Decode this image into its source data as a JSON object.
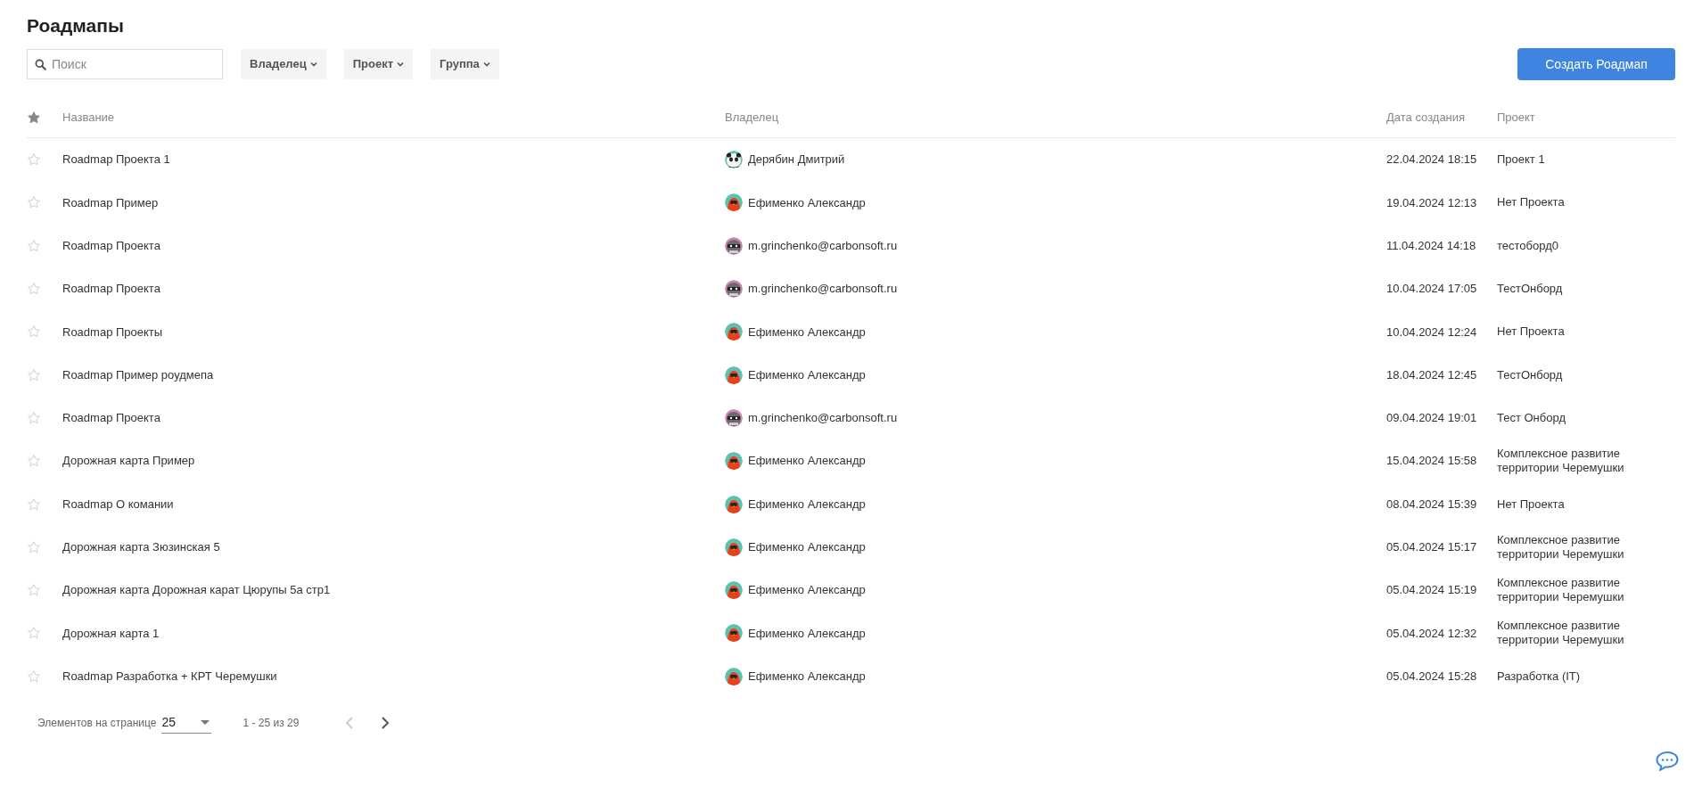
{
  "page": {
    "title": "Роадмапы"
  },
  "toolbar": {
    "search": {
      "placeholder": "Поиск"
    },
    "filters": [
      "Владелец",
      "Проект",
      "Группа"
    ],
    "create_button": "Создать Роадмап"
  },
  "table": {
    "columns": [
      {
        "kind": "favorite"
      },
      {
        "kind": "text",
        "label": "Название"
      },
      {
        "kind": "text",
        "label": "Владелец"
      },
      {
        "kind": "text",
        "label": "Дата создания"
      },
      {
        "kind": "text",
        "label": "Проект"
      }
    ],
    "rows": [
      {
        "favorite": false,
        "name": "Roadmap Проекта 1",
        "owner": "Дерябин Дмитрий",
        "avatar": {
          "kind": "panda"
        },
        "created": "22.04.2024 18:15",
        "project": "Проект 1"
      },
      {
        "favorite": false,
        "name": "Roadmap Пример",
        "owner": "Ефименко Александр",
        "avatar": {
          "kind": "bird"
        },
        "created": "19.04.2024 12:13",
        "project": "Нет Проекта"
      },
      {
        "favorite": false,
        "name": "Roadmap Проекта",
        "owner": "m.grinchenko@carbonsoft.ru",
        "avatar": {
          "kind": "raccoon"
        },
        "created": "11.04.2024 14:18",
        "project": "тестоборд0"
      },
      {
        "favorite": false,
        "name": "Roadmap Проекта",
        "owner": "m.grinchenko@carbonsoft.ru",
        "avatar": {
          "kind": "raccoon"
        },
        "created": "10.04.2024 17:05",
        "project": "ТестОнборд"
      },
      {
        "favorite": false,
        "name": "Roadmap Проекты",
        "owner": "Ефименко Александр",
        "avatar": {
          "kind": "bird"
        },
        "created": "10.04.2024 12:24",
        "project": "Нет Проекта"
      },
      {
        "favorite": false,
        "name": "Roadmap Пример роудмепа",
        "owner": "Ефименко Александр",
        "avatar": {
          "kind": "bird"
        },
        "created": "18.04.2024 12:45",
        "project": "ТестОнборд"
      },
      {
        "favorite": false,
        "name": "Roadmap Проекта",
        "owner": "m.grinchenko@carbonsoft.ru",
        "avatar": {
          "kind": "raccoon"
        },
        "created": "09.04.2024 19:01",
        "project": "Тест Онборд"
      },
      {
        "favorite": false,
        "name": "Дорожная карта Пример",
        "owner": "Ефименко Александр",
        "avatar": {
          "kind": "bird"
        },
        "created": "15.04.2024 15:58",
        "project": "Комплексное развитие территории Черемушки"
      },
      {
        "favorite": false,
        "name": "Roadmap О комании",
        "owner": "Ефименко Александр",
        "avatar": {
          "kind": "bird"
        },
        "created": "08.04.2024 15:39",
        "project": "Нет Проекта"
      },
      {
        "favorite": false,
        "name": "Дорожная карта Зюзинская 5",
        "owner": "Ефименко Александр",
        "avatar": {
          "kind": "bird"
        },
        "created": "05.04.2024 15:17",
        "project": "Комплексное развитие территории Черемушки"
      },
      {
        "favorite": false,
        "name": "Дорожная карта Дорожная карат Цюрупы 5а стр1",
        "owner": "Ефименко Александр",
        "avatar": {
          "kind": "bird"
        },
        "created": "05.04.2024 15:19",
        "project": "Комплексное развитие территории Черемушки"
      },
      {
        "favorite": false,
        "name": "Дорожная карта 1",
        "owner": "Ефименко Александр",
        "avatar": {
          "kind": "bird"
        },
        "created": "05.04.2024 12:32",
        "project": "Комплексное развитие территории Черемушки"
      },
      {
        "favorite": false,
        "name": "Roadmap Разработка + КРТ Черемушки",
        "owner": "Ефименко Александр",
        "avatar": {
          "kind": "bird"
        },
        "created": "05.04.2024 15:28",
        "project": "Разработка (IT)"
      }
    ]
  },
  "pagination": {
    "label": "Элементов на странице",
    "page_size": "25",
    "range": "1 - 25 из 29",
    "prev_disabled": true,
    "next_disabled": false
  }
}
